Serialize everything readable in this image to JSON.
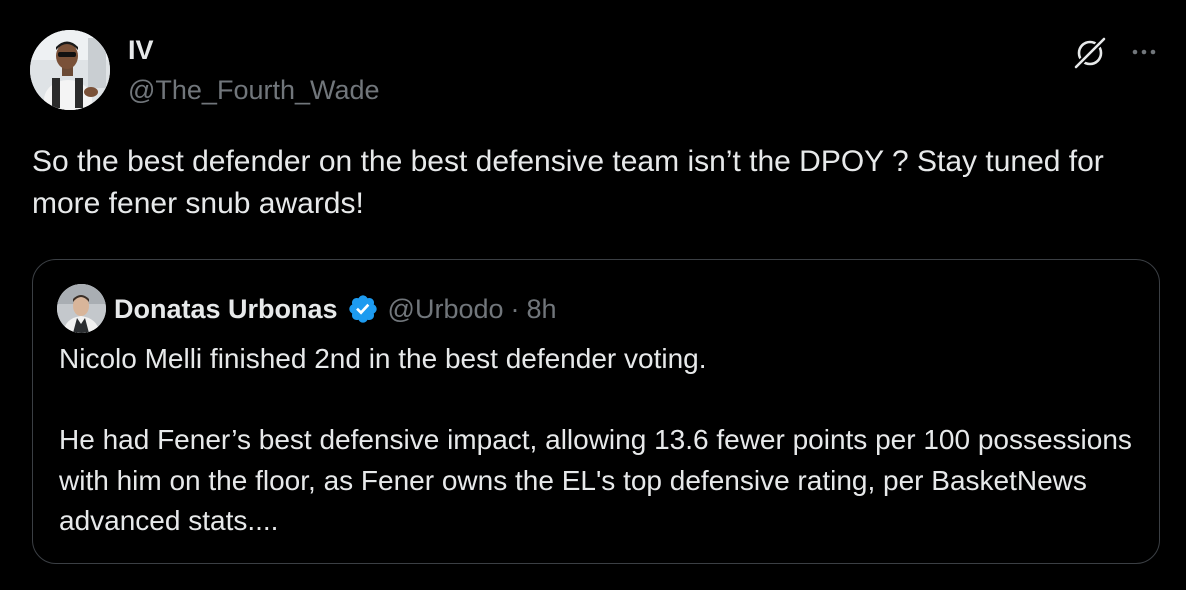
{
  "tweet": {
    "author": {
      "name": "IV",
      "handle": "@The_Fourth_Wade",
      "avatar_icon": "avatar-photo-man-sunglasses"
    },
    "text": "So the best defender on the best defensive team isn’t the DPOY ? Stay tuned for more fener snub awards!",
    "actions": {
      "grok_icon": "grok-icon",
      "more_icon": "more-options-icon"
    }
  },
  "quoted_tweet": {
    "author": {
      "name": "Donatas Urbonas",
      "verified": true,
      "handle": "@Urbodo",
      "separator": "·",
      "time": "8h",
      "avatar_icon": "avatar-photo-man"
    },
    "paragraphs": [
      "Nicolo Melli finished 2nd in the best defender voting.",
      "He had Fener’s best defensive impact, allowing 13.6 fewer points per 100 possessions with him on the floor, as Fener owns the EL's top defensive rating, per BasketNews advanced stats...."
    ]
  },
  "colors": {
    "background": "#000000",
    "primary_text": "#e7e9ea",
    "secondary_text": "#71767b",
    "border": "#3b3f44",
    "verified_blue": "#1d9bf0"
  }
}
